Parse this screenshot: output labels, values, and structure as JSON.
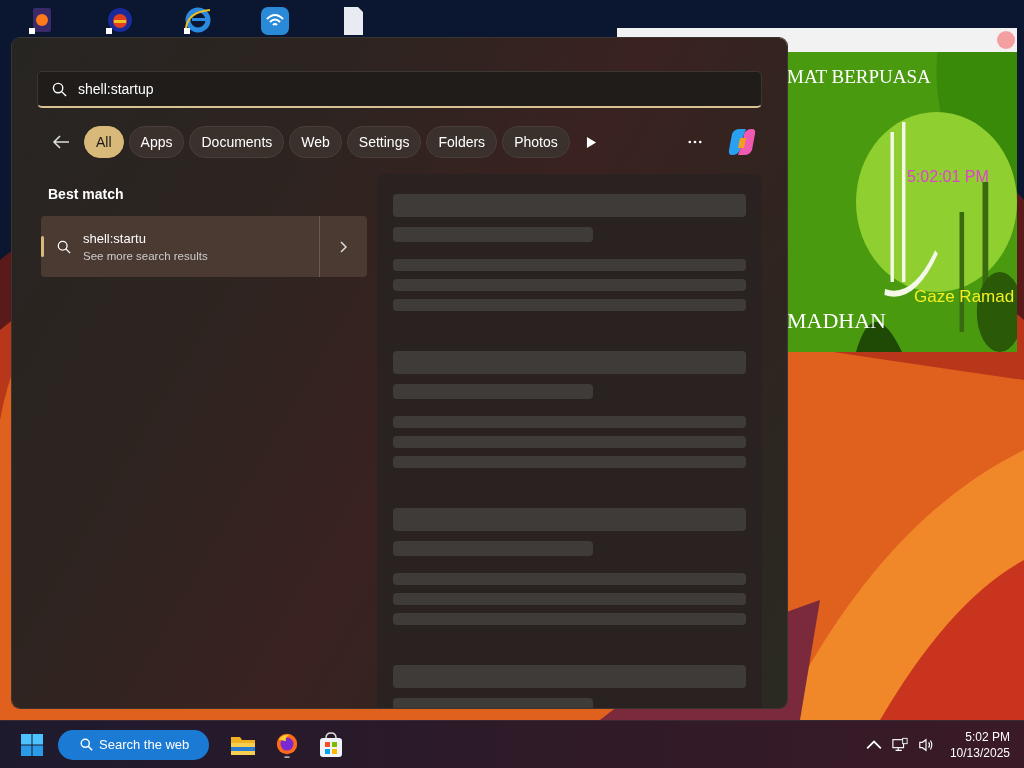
{
  "widget": {
    "banner_top": "MAT BERPUASA",
    "clock": "5:02:01 PM",
    "caption": "Gaze Ramad",
    "banner_bottom": "MADHAN"
  },
  "search": {
    "value": "shell:startup"
  },
  "filters": [
    {
      "label": "All",
      "selected": true
    },
    {
      "label": "Apps",
      "selected": false
    },
    {
      "label": "Documents",
      "selected": false
    },
    {
      "label": "Web",
      "selected": false
    },
    {
      "label": "Settings",
      "selected": false
    },
    {
      "label": "Folders",
      "selected": false
    },
    {
      "label": "Photos",
      "selected": false
    }
  ],
  "best_match": {
    "heading": "Best match",
    "title": "shell:startu",
    "subtitle": "See more search results",
    "selected": true
  },
  "taskbar": {
    "search_button": "Search the web",
    "time": "5:02 PM",
    "date": "10/13/2025"
  }
}
